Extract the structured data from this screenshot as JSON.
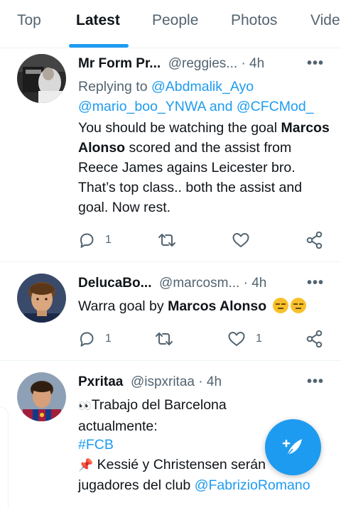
{
  "tabs": [
    {
      "label": "Top"
    },
    {
      "label": "Latest"
    },
    {
      "label": "People"
    },
    {
      "label": "Photos"
    },
    {
      "label": "Vide"
    }
  ],
  "tweets": [
    {
      "name": "Mr Form Pr...",
      "handle": "@reggies...",
      "sep": "·",
      "time": "4h",
      "replying_prefix": "Replying to ",
      "replying_line1": "@Abdmalik_Ayo",
      "replying_line2a": "@mario_boo_YNWA",
      "replying_and": " and ",
      "replying_line2b": "@CFCMod_",
      "text_a": "You should be watching the goal ",
      "text_bold": "Marcos Alonso",
      "text_b": " scored and the assist from Reece James agains Leicester bro. That’s top class.. both the assist and goal. Now rest.",
      "reply_count": "1",
      "retweet_count": "",
      "like_count": ""
    },
    {
      "name": "DelucaBo...",
      "handle": "@marcosm...",
      "sep": "·",
      "time": "4h",
      "text_a": "Warra goal by ",
      "text_bold": "Marcos Alonso",
      "emoji": "😑😑",
      "reply_count": "1",
      "retweet_count": "",
      "like_count": "1"
    },
    {
      "name": "Pxritaa",
      "handle": "@ispxritaa",
      "sep": "·",
      "time": "4h",
      "eyes": "👀",
      "line1": "Trabajo del Barcelona actualmente:",
      "hashtag": "#FCB",
      "pin": "📌",
      "line3": " Kessié y Christensen serán jugadores del club ",
      "mention": "@FabrizioRomano"
    }
  ],
  "icons": [
    "reply-icon",
    "retweet-icon",
    "like-icon",
    "share-icon",
    "more-icon",
    "compose-icon"
  ],
  "colors": {
    "accent": "#1d9bf0",
    "muted": "#536471",
    "text": "#0f1419"
  }
}
